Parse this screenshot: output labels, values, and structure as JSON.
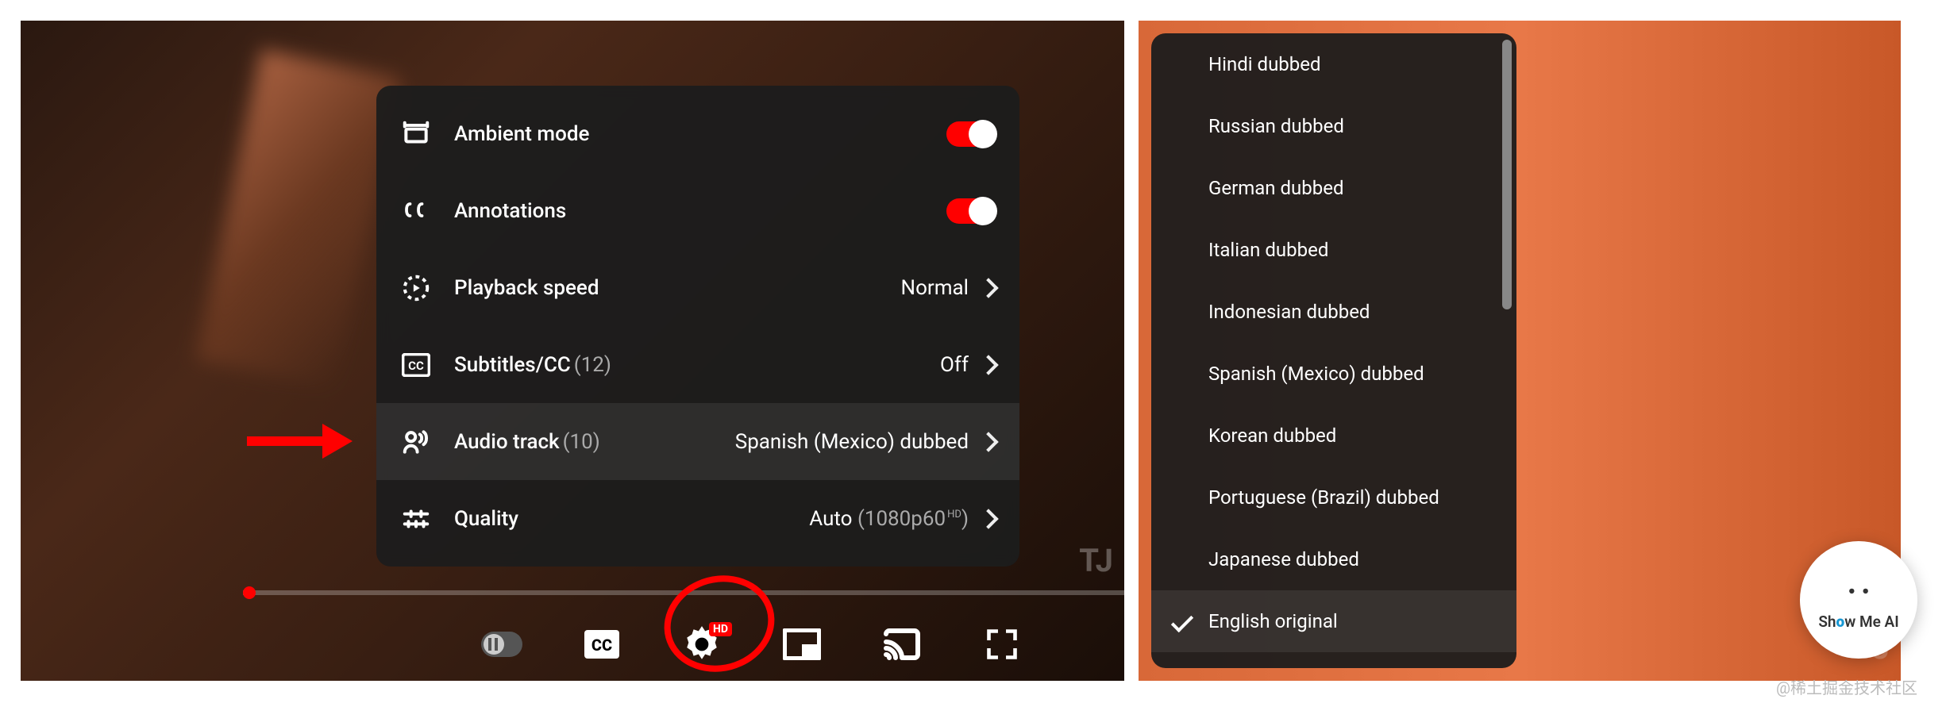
{
  "settings": {
    "ambient": {
      "label": "Ambient mode",
      "on": true
    },
    "annotations": {
      "label": "Annotations",
      "on": true
    },
    "playback": {
      "label": "Playback speed",
      "value": "Normal"
    },
    "subtitles": {
      "label": "Subtitles/CC",
      "count": "(12)",
      "value": "Off"
    },
    "audio": {
      "label": "Audio track",
      "count": "(10)",
      "value": "Spanish (Mexico) dubbed"
    },
    "quality": {
      "label": "Quality",
      "value_prefix": "Auto",
      "value_detail": "(1080p60",
      "hd": "HD",
      "value_suffix": ")"
    }
  },
  "audio_tracks": {
    "items": [
      {
        "label": "Hindi dubbed"
      },
      {
        "label": "Russian dubbed"
      },
      {
        "label": "German dubbed"
      },
      {
        "label": "Italian dubbed"
      },
      {
        "label": "Indonesian dubbed"
      },
      {
        "label": "Spanish (Mexico) dubbed"
      },
      {
        "label": "Korean dubbed"
      },
      {
        "label": "Portuguese (Brazil) dubbed"
      },
      {
        "label": "Japanese dubbed"
      },
      {
        "label": "English original",
        "selected": true
      }
    ]
  },
  "watermark": {
    "tj": "TJ",
    "logo": "ShowMeAI",
    "credit": "@稀土掘金技术社区"
  }
}
